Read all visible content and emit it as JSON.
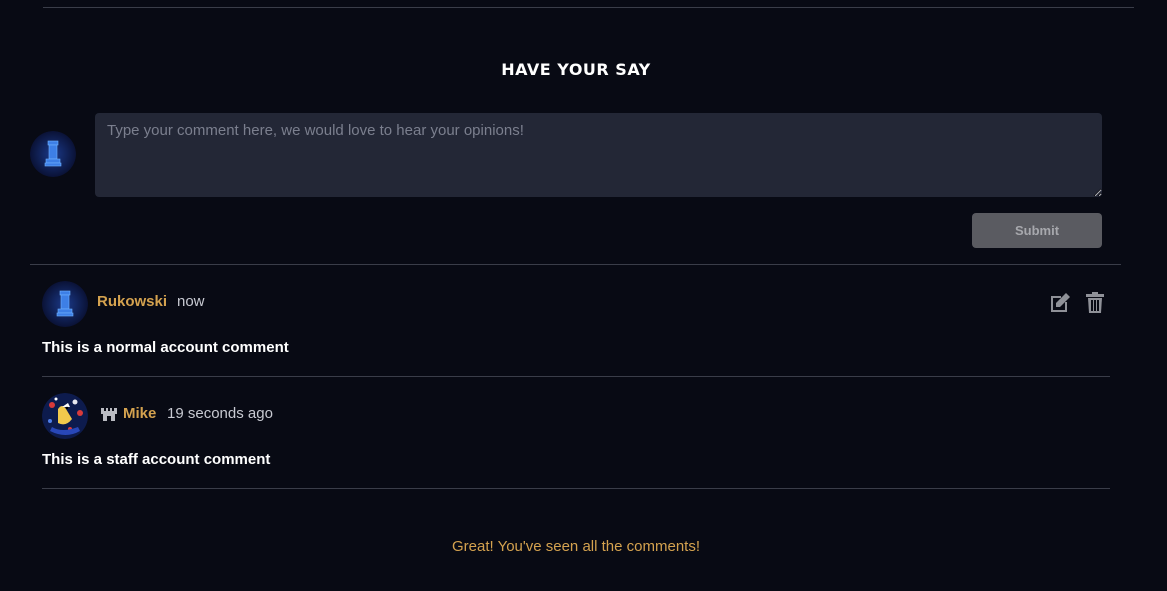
{
  "section": {
    "title": "Have your say"
  },
  "compose": {
    "placeholder": "Type your comment here, we would love to hear your opinions!",
    "value": "",
    "submit_label": "Submit"
  },
  "comments": [
    {
      "author": "Rukowski",
      "time": "now",
      "body": "This is a normal account comment",
      "is_staff": false,
      "actions": [
        "edit-icon",
        "trash-icon"
      ]
    },
    {
      "author": "Mike",
      "time": "19 seconds ago",
      "body": "This is a staff account comment",
      "is_staff": true,
      "badge_icon": "castle-crown-icon"
    }
  ],
  "footer": {
    "end_message": "Great! You've seen all the comments!"
  },
  "colors": {
    "background": "#080a14",
    "accent_gold": "#d4a24f",
    "input_bg": "#232736",
    "submit_bg": "#5a5b61",
    "divider": "#3a3d49",
    "icon_gray": "#8f9198"
  }
}
